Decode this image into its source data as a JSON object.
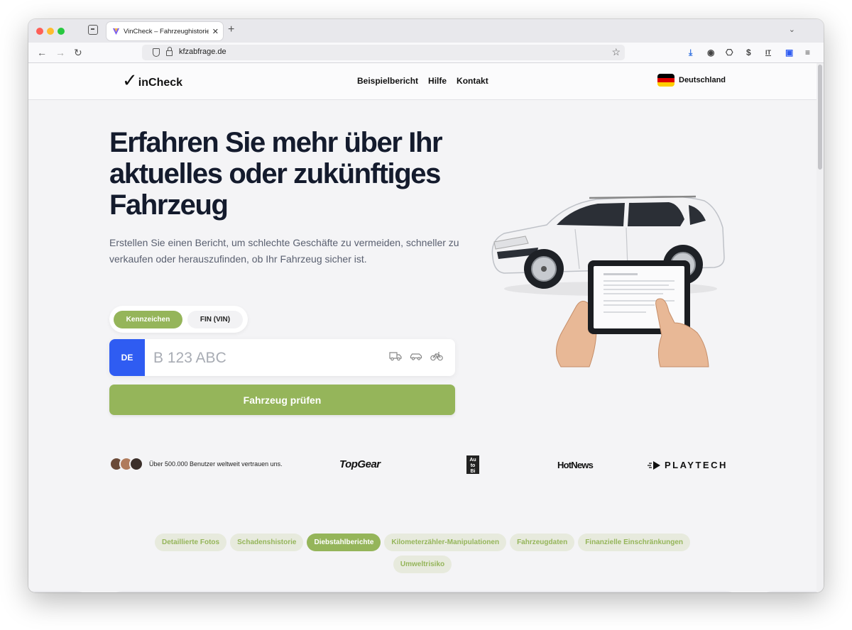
{
  "browser": {
    "tab_title": "VinCheck – Fahrzeughistorie prü",
    "url": "kfzabfrage.de"
  },
  "site": {
    "logo_v": "✓",
    "logo_text": "inCheck",
    "nav": [
      "Beispielbericht",
      "Hilfe",
      "Kontakt"
    ],
    "country": "Deutschland",
    "flag_colors": [
      "#000000",
      "#dd0000",
      "#ffce00"
    ]
  },
  "hero": {
    "title": "Erfahren Sie mehr über Ihr aktuelles oder zukünftiges Fahrzeug",
    "subtitle": "Erstellen Sie einen Bericht, um schlechte Geschäfte zu vermeiden, schneller zu verkaufen oder herauszufinden, ob Ihr Fahrzeug sicher ist.",
    "tab_active": "Kennzeichen",
    "tab_inactive": "FIN (VIN)",
    "plate_country": "DE",
    "plate_placeholder": "B 123 ABC",
    "vehicle_icons": [
      "truck-icon",
      "car-icon",
      "bicycle-icon"
    ],
    "submit_label": "Fahrzeug prüfen"
  },
  "trust": {
    "text": "Über 500.000 Benutzer weltweit vertrauen uns.",
    "brands": {
      "topgear": "TopGear",
      "autobild": "Auto Bild",
      "hotnews": "HotNews",
      "playtech": "PLAYTECH"
    }
  },
  "features": {
    "chips": [
      {
        "label": "Detaillierte Fotos",
        "active": false
      },
      {
        "label": "Schadenshistorie",
        "active": false
      },
      {
        "label": "Diebstahlberichte",
        "active": true
      },
      {
        "label": "Kilometerzähler-Manipulationen",
        "active": false
      },
      {
        "label": "Fahrzeugdaten",
        "active": false
      },
      {
        "label": "Finanzielle Einschränkungen",
        "active": false
      },
      {
        "label": "Umweltrisiko",
        "active": false
      }
    ]
  },
  "colors": {
    "accent_green": "#95b55a",
    "plate_blue": "#2f5cf2",
    "title_dark": "#141b2d"
  }
}
